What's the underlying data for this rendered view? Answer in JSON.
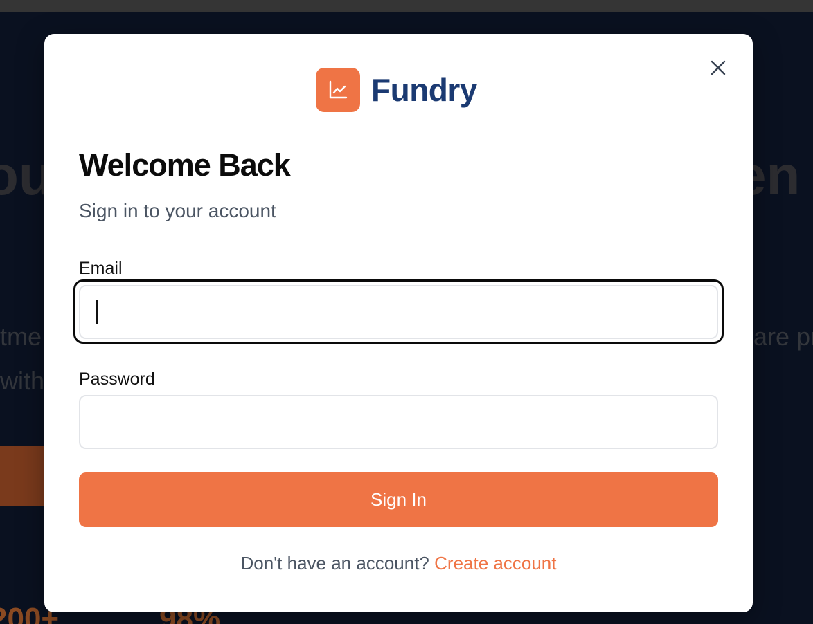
{
  "brand": {
    "name": "Fundry",
    "logo_icon": "chart-line-icon",
    "accent_color": "#ef7445",
    "name_color": "#1b3a72"
  },
  "modal": {
    "close_icon": "close-icon",
    "title": "Welcome Back",
    "subtitle": "Sign in to your account",
    "email_label": "Email",
    "email_value": "",
    "password_label": "Password",
    "password_value": "",
    "submit_label": "Sign In",
    "footer_prompt": "Don't have an account?",
    "footer_link": "Create account"
  }
}
